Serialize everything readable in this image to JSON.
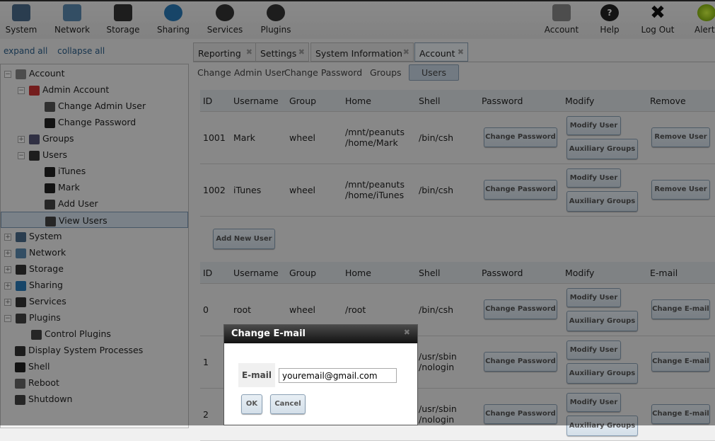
{
  "toolbar": {
    "left": [
      {
        "label": "System",
        "icon": "system-icon"
      },
      {
        "label": "Network",
        "icon": "network-icon"
      },
      {
        "label": "Storage",
        "icon": "storage-icon"
      },
      {
        "label": "Sharing",
        "icon": "sharing-icon"
      },
      {
        "label": "Services",
        "icon": "services-icon"
      },
      {
        "label": "Plugins",
        "icon": "plugins-icon"
      }
    ],
    "right": [
      {
        "label": "Account",
        "icon": "account-icon"
      },
      {
        "label": "Help",
        "icon": "help-icon"
      },
      {
        "label": "Log Out",
        "icon": "logout-icon"
      },
      {
        "label": "Alert",
        "icon": "alert-icon"
      }
    ]
  },
  "tree_links": {
    "expand": "expand all",
    "collapse": "collapse all"
  },
  "tree": [
    "Account",
    "Admin Account",
    "Change Admin User",
    "Change Password",
    "Groups",
    "Users",
    "iTunes",
    "Mark",
    "Add User",
    "View Users",
    "System",
    "Network",
    "Storage",
    "Sharing",
    "Services",
    "Plugins",
    "Control Plugins",
    "Display System Processes",
    "Shell",
    "Reboot",
    "Shutdown"
  ],
  "tabs": [
    "Reporting",
    "Settings",
    "System Information",
    "Account"
  ],
  "subtabs": [
    "Change Admin User",
    "Change Password",
    "Groups",
    "Users"
  ],
  "users_table": {
    "headers": [
      "ID",
      "Username",
      "Group",
      "Home",
      "Shell",
      "Password",
      "Modify",
      "Remove"
    ],
    "rows": [
      {
        "id": "1001",
        "username": "Mark",
        "group": "wheel",
        "home1": "/mnt/peanuts",
        "home2": "/home/Mark",
        "shell": "/bin/csh"
      },
      {
        "id": "1002",
        "username": "iTunes",
        "group": "wheel",
        "home1": "/mnt/peanuts",
        "home2": "/home/iTunes",
        "shell": "/bin/csh"
      }
    ]
  },
  "buttons": {
    "change_password": "Change Password",
    "modify_user": "Modify User",
    "aux_groups": "Auxiliary Groups",
    "remove_user": "Remove User",
    "change_email": "Change E-mail",
    "add_new_user": "Add New User"
  },
  "system_table": {
    "headers": [
      "ID",
      "Username",
      "Group",
      "Home",
      "Shell",
      "Password",
      "Modify",
      "E-mail"
    ],
    "rows": [
      {
        "id": "0",
        "username": "root",
        "group": "wheel",
        "home": "/root",
        "shell1": "/bin/csh",
        "shell2": ""
      },
      {
        "id": "1",
        "username": "",
        "group": "",
        "home": "",
        "shell1": "/usr/sbin",
        "shell2": "/nologin"
      },
      {
        "id": "2",
        "username": "",
        "group": "",
        "home": "",
        "shell1": "/usr/sbin",
        "shell2": "/nologin"
      }
    ]
  },
  "dialog": {
    "title": "Change E-mail",
    "label": "E-mail",
    "value": "youremail@gmail.com",
    "ok": "OK",
    "cancel": "Cancel"
  }
}
